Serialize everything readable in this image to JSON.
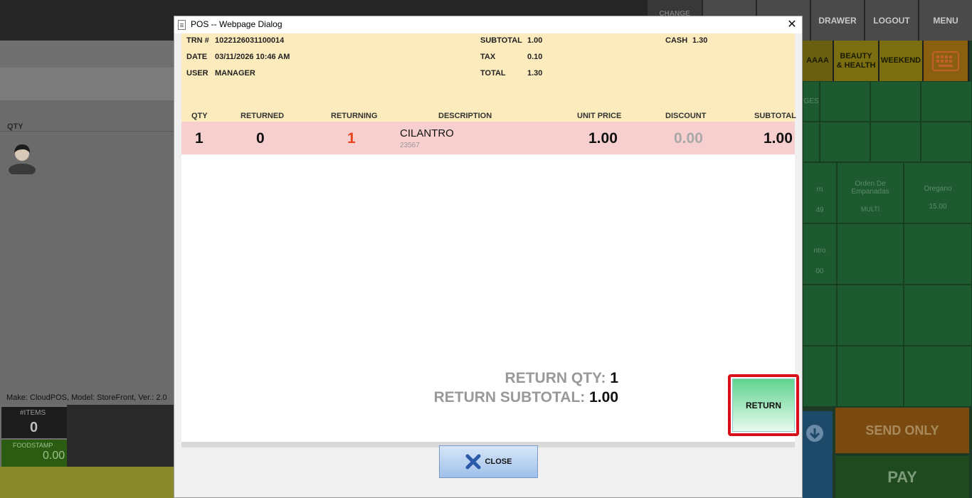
{
  "background": {
    "topbar": {
      "change_label": "CHANGE",
      "drawer_label": "DRAWER",
      "logout_label": "LOGOUT",
      "menu_label": "MENU"
    },
    "categories": [
      "AAAA",
      "BEAUTY\n& HEALTH",
      "WEEKEND"
    ],
    "tiles": {
      "ges": "GES",
      "orn": "rn",
      "orn_price": "49",
      "empanadas": "Orden De Empanadas",
      "empanadas_sub": "MULTI",
      "oregano": "Oregano",
      "oregano_price": "15.00",
      "ntro": "ntro",
      "ntro_price": "00"
    },
    "qty_header": "QTY",
    "make_text": "Make: CloudPOS, Model: StoreFront, Ver.: 2.0",
    "items_label": "#ITEMS",
    "items_value": "0",
    "foodstamp_label": "FOODSTAMP",
    "foodstamp_value": "0.00",
    "send_only_label": "SEND ONLY",
    "pay_label": "PAY"
  },
  "dialog": {
    "title": "POS -- Webpage Dialog",
    "close_glyph": "✕",
    "info": {
      "trn_label": "TRN #",
      "trn_value": "1022126031100014",
      "date_label": "DATE",
      "date_value": "03/11/2026 10:46 AM",
      "user_label": "USER",
      "user_value": "MANAGER",
      "subtotal_label": "SUBTOTAL",
      "subtotal_value": "1.00",
      "tax_label": "TAX",
      "tax_value": "0.10",
      "total_label": "TOTAL",
      "total_value": "1.30",
      "cash_label": "CASH",
      "cash_value": "1.30"
    },
    "table": {
      "headers": {
        "qty": "QTY",
        "returned": "RETURNED",
        "returning": "RETURNING",
        "description": "DESCRIPTION",
        "unit_price": "UNIT PRICE",
        "discount": "DISCOUNT",
        "subtotal": "SUBTOTAL"
      },
      "rows": [
        {
          "qty": "1",
          "returned": "0",
          "returning": "1",
          "description": "CILANTRO",
          "sku": "23567",
          "unit_price": "1.00",
          "discount": "0.00",
          "subtotal": "1.00"
        }
      ]
    },
    "summary": {
      "return_qty_label": "RETURN QTY:",
      "return_qty_value": "1",
      "return_subtotal_label": "RETURN SUBTOTAL:",
      "return_subtotal_value": "1.00"
    },
    "return_button_label": "RETURN",
    "close_button_label": "CLOSE"
  },
  "colors": {
    "info_bg": "#fcebbd",
    "row_bg": "#f8cfcf",
    "returning_value": "#e8431a",
    "highlight_border": "#d8101a"
  }
}
